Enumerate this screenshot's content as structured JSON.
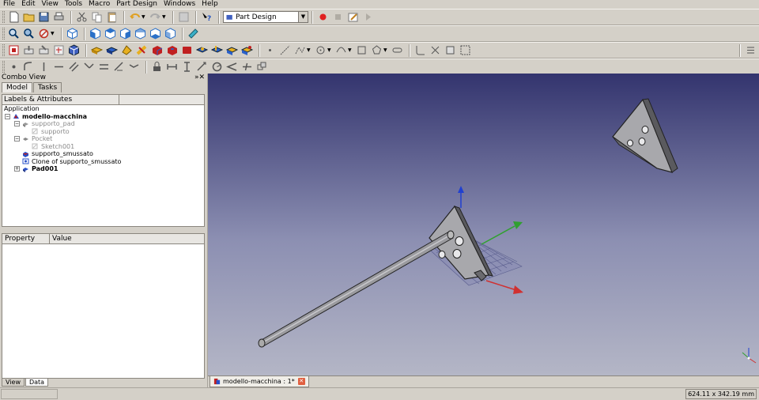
{
  "menubar": {
    "items": [
      "File",
      "Edit",
      "View",
      "Tools",
      "Macro",
      "Part Design",
      "Windows",
      "Help"
    ]
  },
  "toolbar": {
    "workbench": "Part Design"
  },
  "combo": {
    "title": "Combo View",
    "controls": "»✕",
    "tabs": [
      "Model",
      "Tasks"
    ]
  },
  "tree": {
    "header": "Labels & Attributes",
    "root": "Application",
    "items": [
      {
        "label": "modello-macchina",
        "level": 0,
        "bold": true,
        "dim": false,
        "expander": "−"
      },
      {
        "label": "supporto_pad",
        "level": 1,
        "bold": false,
        "dim": true,
        "expander": "−"
      },
      {
        "label": "supporto",
        "level": 2,
        "bold": false,
        "dim": true,
        "expander": ""
      },
      {
        "label": "Pocket",
        "level": 1,
        "bold": false,
        "dim": true,
        "expander": "−"
      },
      {
        "label": "Sketch001",
        "level": 2,
        "bold": false,
        "dim": true,
        "expander": ""
      },
      {
        "label": "supporto_smussato",
        "level": 1,
        "bold": false,
        "dim": false,
        "expander": ""
      },
      {
        "label": "Clone of supporto_smussato",
        "level": 1,
        "bold": false,
        "dim": false,
        "expander": ""
      },
      {
        "label": "Pad001",
        "level": 1,
        "bold": true,
        "dim": false,
        "expander": "+"
      }
    ]
  },
  "property": {
    "col_property": "Property",
    "col_value": "Value",
    "tabs": [
      "View",
      "Data"
    ]
  },
  "document": {
    "tab_label": "modello-macchina : 1*"
  },
  "status": {
    "dimensions": "624.11 x 342.19 mm"
  },
  "colors": {
    "accent": "#2a5fd8",
    "record": "#e02020",
    "axis_x": "#d03030",
    "axis_y": "#30a030",
    "axis_z": "#2040d0"
  }
}
